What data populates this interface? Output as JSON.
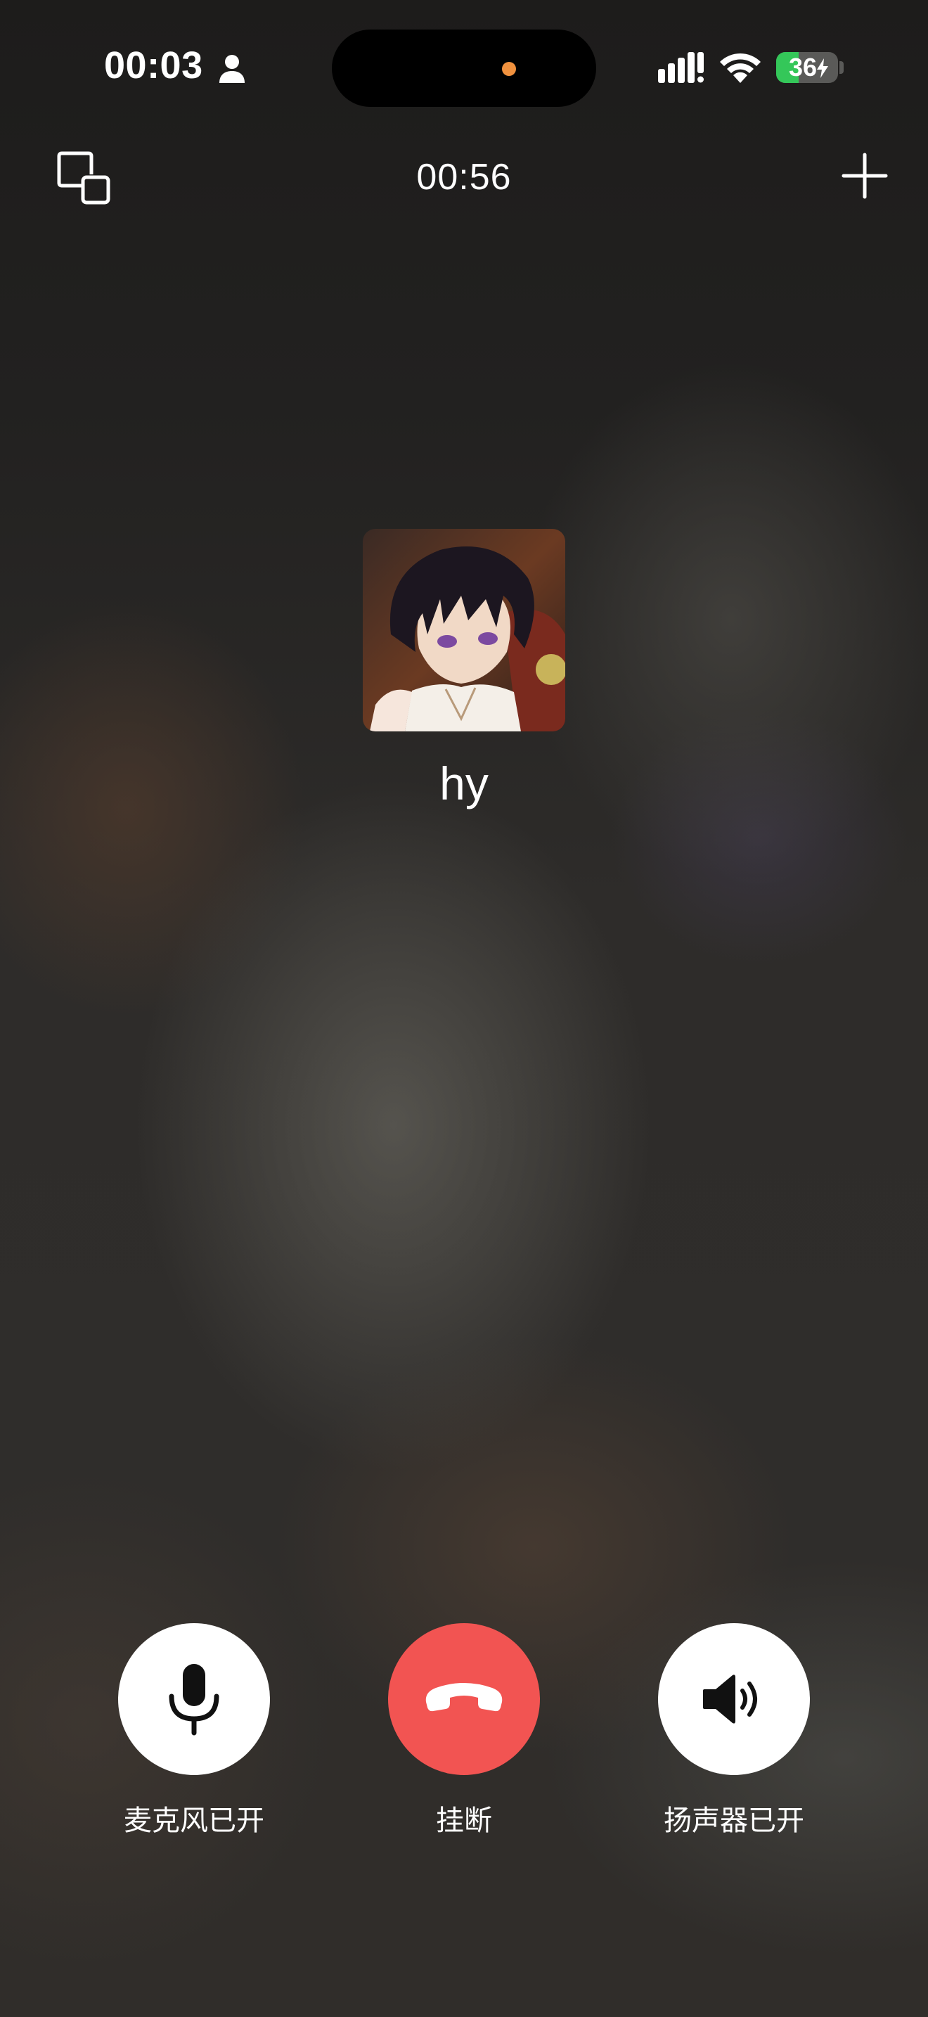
{
  "status_bar": {
    "time": "00:03",
    "battery_level": "36",
    "battery_fraction": 0.36,
    "island_dot_color": "#f0913e",
    "icons": [
      "person-icon",
      "cellular-signal-icon",
      "wifi-icon",
      "battery-icon",
      "charging-bolt-icon"
    ]
  },
  "call": {
    "duration": "00:56",
    "contact_name": "hy",
    "icons": [
      "minimize-window-icon",
      "add-participant-icon"
    ]
  },
  "controls": {
    "microphone_label": "麦克风已开",
    "hangup_label": "挂断",
    "speaker_label": "扬声器已开",
    "hangup_color": "#f25452",
    "icons": [
      "microphone-icon",
      "hangup-phone-icon",
      "speaker-icon"
    ]
  }
}
